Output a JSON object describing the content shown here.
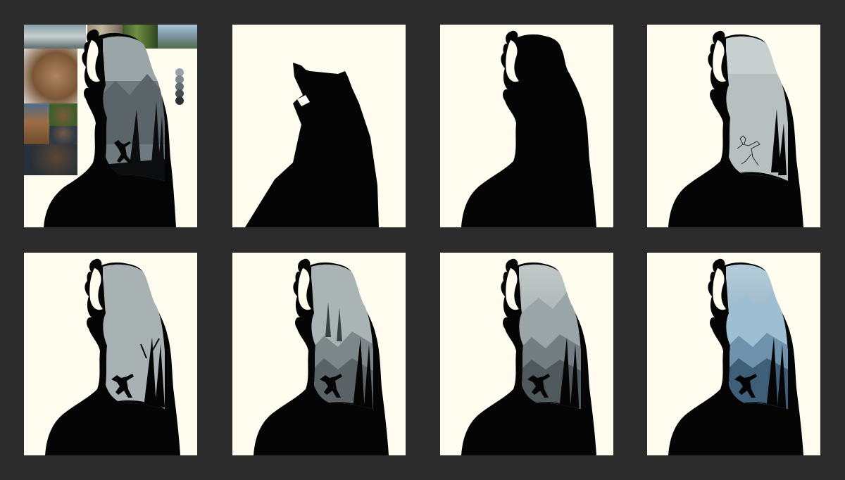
{
  "canvas": {
    "background": "#2b2b2b",
    "panel_background": "#fdfcef"
  },
  "panels": [
    {
      "step": 1,
      "content": "reference-collage-and-sketch"
    },
    {
      "step": 2,
      "content": "rough-silhouette"
    },
    {
      "step": 3,
      "content": "refined-silhouette"
    },
    {
      "step": 4,
      "content": "hunter-line-sketch"
    },
    {
      "step": 5,
      "content": "flat-grey-fill"
    },
    {
      "step": 6,
      "content": "forest-layers"
    },
    {
      "step": 7,
      "content": "atmosphere-mountains"
    },
    {
      "step": 8,
      "content": "final-blue-color"
    }
  ],
  "palette": {
    "swatches": [
      "#9aa4a8",
      "#7f898d",
      "#636c70",
      "#474e52",
      "#2c3134"
    ],
    "silhouette": "#050505",
    "sky_grey": "#a9b5b6",
    "sky_blue": "#8fb2c8",
    "mid_tone": "#5f6b6e"
  },
  "reference_photos": [
    "snowy-forest-photo",
    "bare-trees-photo",
    "pine-forest-photo",
    "mountain-river-photo",
    "roaring-bear-photo",
    "standing-bear-photo",
    "bear-head-photo",
    "hunter-portrait-photo",
    "hunter-fur-photo"
  ]
}
